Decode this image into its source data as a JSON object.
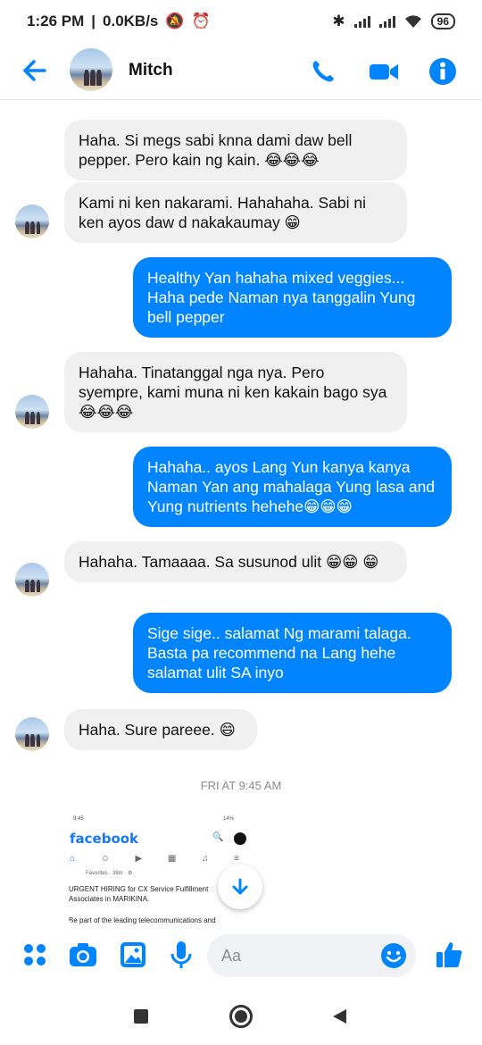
{
  "status_bar": {
    "time": "1:26 PM",
    "speed": "0.0KB/s",
    "battery": "96"
  },
  "header": {
    "contact_name": "Mitch",
    "back_icon": "arrow-left-icon",
    "call_icon": "phone-icon",
    "video_icon": "video-icon",
    "info_icon": "info-icon"
  },
  "messages": [
    {
      "text": "Haha. Si megs sabi knna dami daw bell pepper. Pero kain ng kain. 😂😂😂"
    },
    {
      "text": "Kami ni ken nakarami. Hahahaha. Sabi ni ken ayos daw d nakakaumay 😁"
    },
    {
      "text": "Healthy Yan hahaha mixed veggies... Haha pede Naman nya tanggalin Yung bell pepper"
    },
    {
      "text": "Hahaha. Tinatanggal nga nya. Pero syempre, kami muna ni ken kakain bago sya 😂😂😂"
    },
    {
      "text": "Hahaha.. ayos Lang Yun kanya kanya Naman Yan ang mahalaga Yung lasa and Yung nutrients hehehe😁😁😁"
    },
    {
      "text": "Hahaha. Tamaaaa. Sa susunod ulit 😁😁 😁"
    },
    {
      "text": "Sige sige.. salamat Ng marami talaga. Basta pa recommend na Lang hehe salamat ulit SA inyo"
    },
    {
      "text": "Haha. Sure pareee. 😄"
    }
  ],
  "divider": "FRI AT 9:45 AM",
  "shared_image": {
    "status_left": "9:45",
    "status_right": "14%",
    "brand": "facebook",
    "favorites": "Favorites · 38m · ⚙",
    "post_text": "URGENT HIRING for CX Service Fulfillment Associates in MARIKINA.",
    "post_text_2": "Be part of the leading telecommunications and"
  },
  "composer": {
    "placeholder": "Aa"
  },
  "colors": {
    "accent": "#0084ff",
    "incoming_bubble": "#f0f0f0"
  }
}
